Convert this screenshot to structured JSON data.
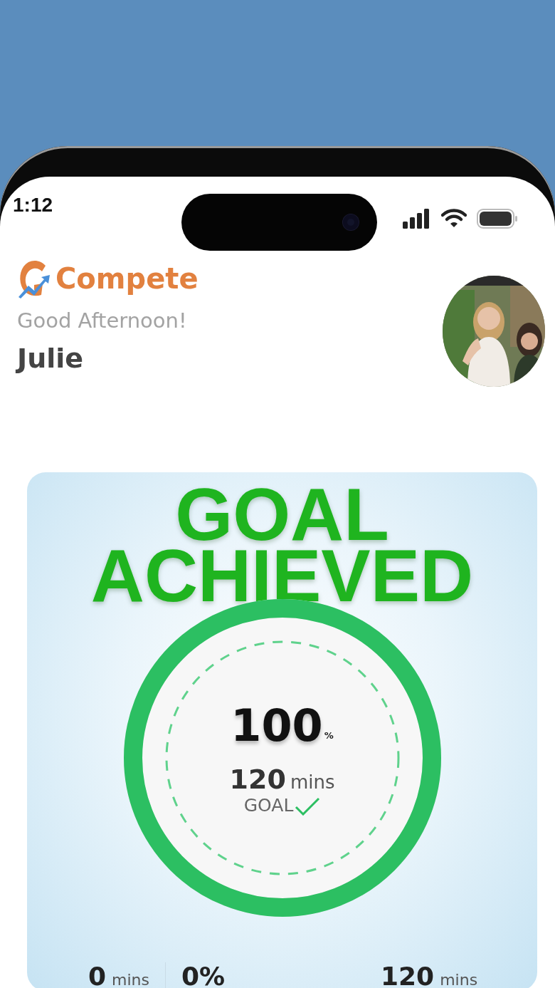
{
  "status_bar": {
    "time": "1:12"
  },
  "header": {
    "brand": "Compete",
    "greeting": "Good Afternoon!",
    "name": "Julie"
  },
  "goal_card": {
    "title_lines": [
      "GOAL",
      "ACHIEVED"
    ],
    "progress": {
      "level": 1,
      "percent": "100",
      "percent_unit": "%",
      "minutes": "120",
      "minutes_unit": "mins",
      "goal_label": "GOAL",
      "achieved": true
    }
  },
  "stats": [
    {
      "value": "0",
      "unit": "mins"
    },
    {
      "value": "0%"
    },
    {
      "value": "120",
      "unit": "mins"
    }
  ]
}
